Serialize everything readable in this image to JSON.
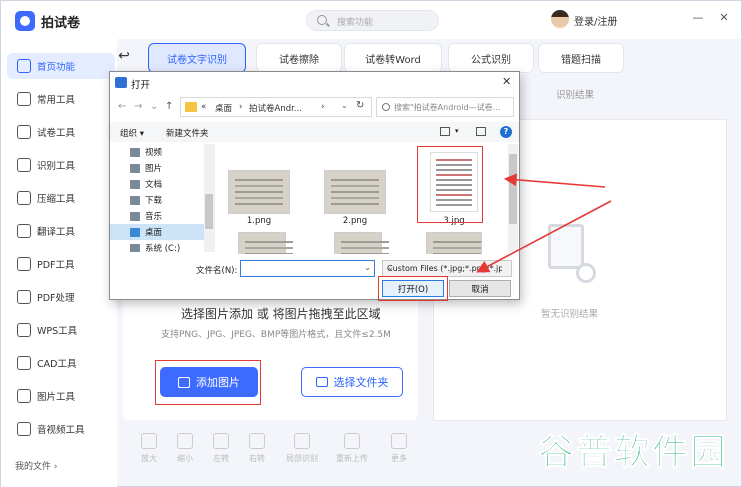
{
  "app": {
    "title": "拍试卷",
    "search_placeholder": "搜索功能",
    "login": "登录/注册",
    "minimize": "—",
    "close": "✕"
  },
  "sidebar": {
    "items": [
      {
        "label": "首页功能",
        "icon": "home-icon"
      },
      {
        "label": "常用工具",
        "icon": "layers-icon"
      },
      {
        "label": "试卷工具",
        "icon": "paper-icon"
      },
      {
        "label": "识别工具",
        "icon": "scan-icon"
      },
      {
        "label": "压缩工具",
        "icon": "compress-icon"
      },
      {
        "label": "翻译工具",
        "icon": "translate-icon"
      },
      {
        "label": "PDF工具",
        "icon": "pdf-icon"
      },
      {
        "label": "PDF处理",
        "icon": "pdf-process-icon"
      },
      {
        "label": "WPS工具",
        "icon": "wps-icon"
      },
      {
        "label": "CAD工具",
        "icon": "cad-icon"
      },
      {
        "label": "图片工具",
        "icon": "image-icon"
      },
      {
        "label": "音视频工具",
        "icon": "video-icon"
      }
    ],
    "my_files": "我的文件 ›"
  },
  "tabs": [
    {
      "label": "试卷文字识别"
    },
    {
      "label": "试卷擦除"
    },
    {
      "label": "试卷转Word"
    },
    {
      "label": "公式识别"
    },
    {
      "label": "错题扫描"
    }
  ],
  "upload": {
    "title": "选择图片添加 或 将图片拖拽至此区域",
    "subtitle": "支持PNG、JPG、JPEG、BMP等图片格式，且文件≤2.5M",
    "add_image": "添加图片",
    "choose_folder": "选择文件夹"
  },
  "result": {
    "title": "识别结果",
    "empty": "暂无识别结果"
  },
  "bottom_tools": [
    "放大",
    "缩小",
    "左转",
    "右转",
    "局部识别",
    "重新上传",
    "更多"
  ],
  "watermark": "谷普软件园",
  "dialog": {
    "title": "打开",
    "close": "✕",
    "breadcrumb": [
      "«",
      "桌面",
      "›",
      "拍试卷Andr...",
      "›"
    ],
    "search_placeholder": "搜索\"拍试卷Android—试卷...",
    "organize": "组织 ▾",
    "new_folder": "新建文件夹",
    "tree": [
      "视频",
      "图片",
      "文档",
      "下载",
      "音乐",
      "桌面",
      "系统 (C:)"
    ],
    "files": [
      "1.png",
      "2.png",
      "3.jpg"
    ],
    "filename_label": "文件名(N):",
    "filename_value": "",
    "filter": "Custom Files (*.jpg;*.png;*.jp",
    "open_button": "打开(O)",
    "cancel_button": "取消"
  },
  "colors": {
    "accent": "#3d6bff",
    "annotation": "#e53935",
    "watermark": "#29b37c"
  }
}
